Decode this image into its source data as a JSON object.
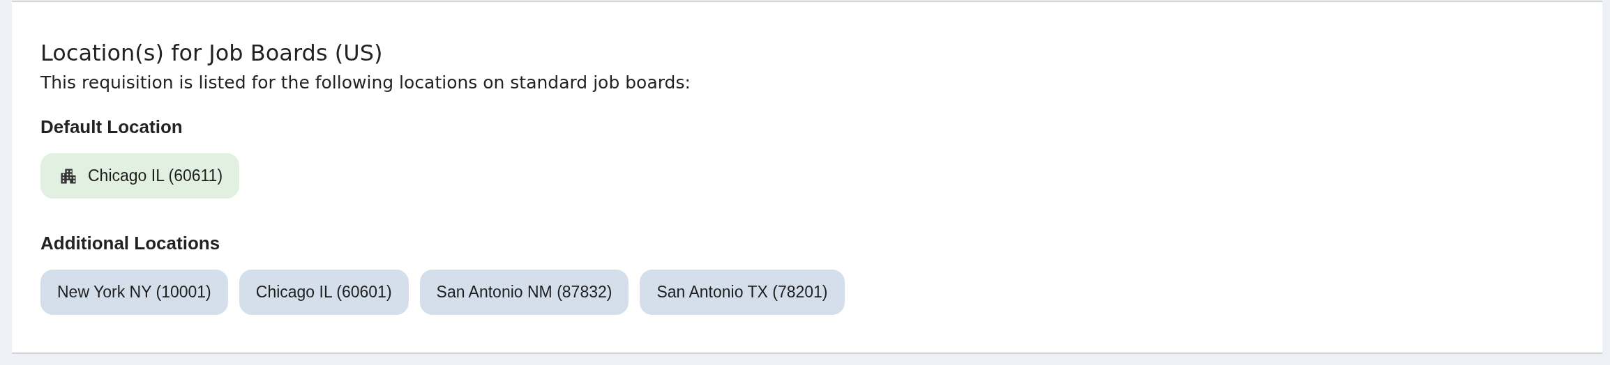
{
  "card": {
    "title": "Location(s) for Job Boards (US)",
    "description": "This requisition is listed for the following locations on standard job boards:",
    "sections": [
      {
        "heading": "Default Location",
        "locations": [
          {
            "label": "Chicago IL (60611)",
            "kind": "default"
          }
        ]
      },
      {
        "heading": "Additional Locations",
        "locations": [
          {
            "label": "New York NY (10001)",
            "kind": "additional"
          },
          {
            "label": "Chicago IL (60601)",
            "kind": "additional"
          },
          {
            "label": "San Antonio NM (87832)",
            "kind": "additional"
          },
          {
            "label": "San Antonio TX (78201)",
            "kind": "additional"
          }
        ]
      }
    ]
  }
}
